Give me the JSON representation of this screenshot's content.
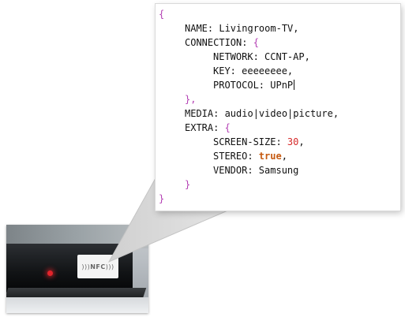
{
  "nfc_label": "NFC",
  "colors": {
    "brace": "#b440b4",
    "number": "#d62a2a",
    "boolean": "#c65a11",
    "led": "#e3242b"
  },
  "code": {
    "open_root": "{",
    "name_key": "NAME: ",
    "name_value": "Livingroom-TV,",
    "connection_key": "CONNECTION: ",
    "connection_open": "{",
    "network_key": "NETWORK: ",
    "network_value": "CCNT-AP,",
    "key_key": "KEY: ",
    "key_value": "eeeeeeee,",
    "protocol_key": "PROTOCOL: ",
    "protocol_value": "UPnP",
    "connection_close": "},",
    "media_key": "MEDIA: ",
    "media_value": "audio|video|picture,",
    "extra_key": "EXTRA: ",
    "extra_open": "{",
    "screen_size_key": "SCREEN-SIZE: ",
    "screen_size_value": "30",
    "screen_size_comma": ",",
    "stereo_key": "STEREO: ",
    "stereo_value": "true",
    "stereo_comma": ",",
    "vendor_key": "VENDOR: ",
    "vendor_value": "Samsung",
    "extra_close": "}",
    "close_root": "}"
  }
}
